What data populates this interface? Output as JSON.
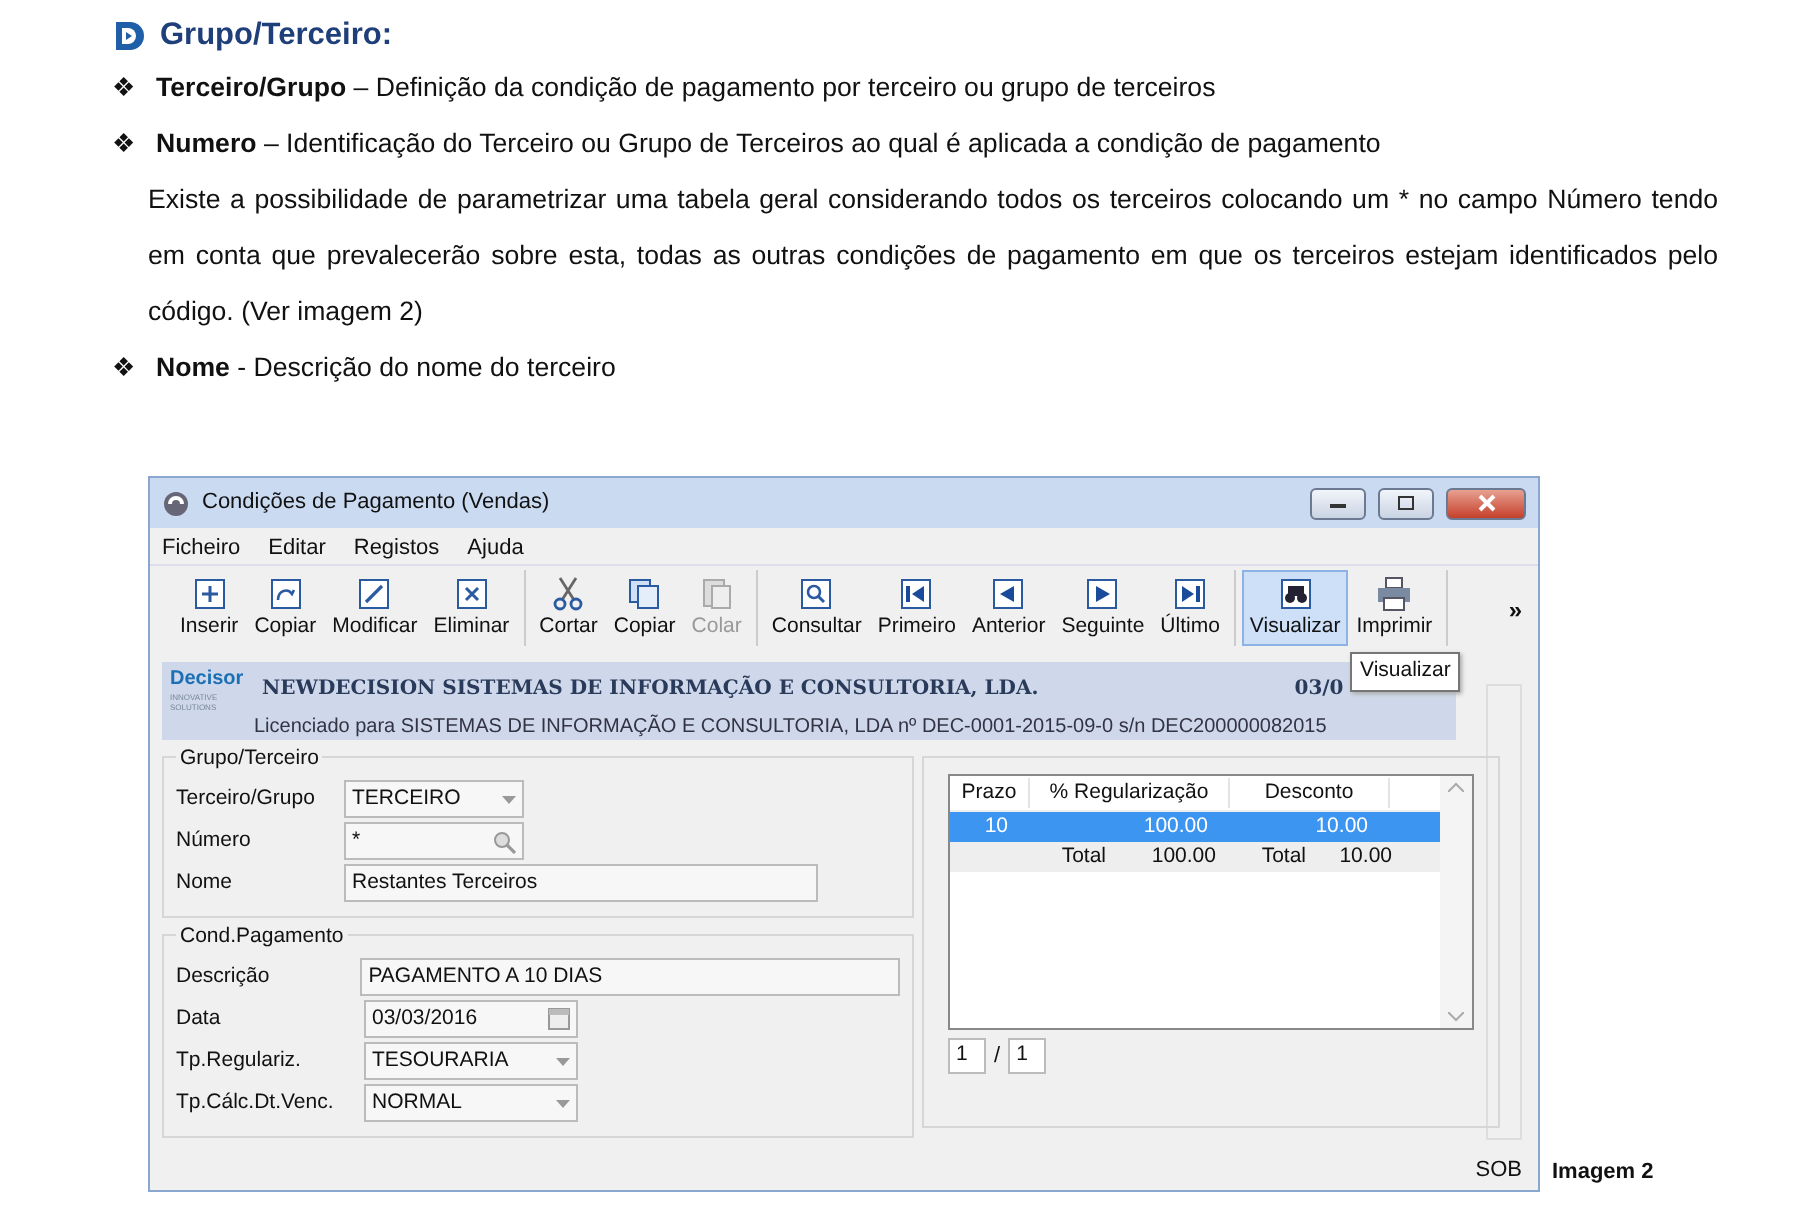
{
  "heading": "Grupo/Terceiro:",
  "items": [
    {
      "kind": "bullet",
      "marker": "❖",
      "text": "**Terceiro/Grupo** – Definição da condição de pagamento por terceiro ou grupo de terceiros"
    },
    {
      "kind": "bullet",
      "marker": "❖",
      "text": "**Numero** – Identificação do Terceiro ou Grupo de Terceiros ao qual é aplicada a condição de pagamento"
    },
    {
      "kind": "para",
      "text": "Existe a possibilidade de parametrizar uma tabela geral considerando todos os terceiros colocando um * no campo Número tendo em conta que prevalecerão sobre esta, todas as outras condições de pagamento em que os terceiros estejam identificados pelo código. (Ver imagem 2)"
    },
    {
      "kind": "bullet",
      "marker": "❖",
      "text": "**Nome** - Descrição do nome do terceiro"
    }
  ],
  "window": {
    "title": "Condições de Pagamento (Vendas)",
    "menu": [
      "Ficheiro",
      "Editar",
      "Registos",
      "Ajuda"
    ],
    "toolbar": [
      [
        {
          "label": "Inserir",
          "disabled": false,
          "selected": false
        },
        {
          "label": "Copiar",
          "disabled": false,
          "selected": false
        },
        {
          "label": "Modificar",
          "disabled": false,
          "selected": false
        },
        {
          "label": "Eliminar",
          "disabled": false,
          "selected": false
        }
      ],
      [
        {
          "label": "Cortar",
          "disabled": false,
          "selected": false
        },
        {
          "label": "Copiar",
          "disabled": false,
          "selected": false
        },
        {
          "label": "Colar",
          "disabled": true,
          "selected": false
        }
      ],
      [
        {
          "label": "Consultar",
          "disabled": false,
          "selected": false
        },
        {
          "label": "Primeiro",
          "disabled": false,
          "selected": false
        },
        {
          "label": "Anterior",
          "disabled": false,
          "selected": false
        },
        {
          "label": "Seguinte",
          "disabled": false,
          "selected": false
        },
        {
          "label": "Último",
          "disabled": false,
          "selected": false
        }
      ],
      [
        {
          "label": "Visualizar",
          "disabled": false,
          "selected": true
        },
        {
          "label": "Imprimir",
          "disabled": false,
          "selected": false
        }
      ]
    ],
    "overflow": "»",
    "tooltip": "Visualizar",
    "header": {
      "logo": "Decisor",
      "logo_sub": "INNOVATIVE SOLUTIONS",
      "company": "NEWDECISION SISTEMAS DE INFORMAÇÃO E CONSULTORIA, LDA.",
      "date": "03/0",
      "license": "Licenciado para  SISTEMAS DE INFORMAÇÃO E CONSULTORIA, LDA nº DEC-0001-2015-09-0 s/n DEC200000082015"
    },
    "groups": [
      {
        "title": "Grupo/Terceiro",
        "fields": [
          {
            "label": "Terceiro/Grupo",
            "kind": "combo",
            "value": "TERCEIRO"
          },
          {
            "label": "Número",
            "kind": "lookup",
            "value": "*"
          },
          {
            "label": "Nome",
            "kind": "text",
            "value": "Restantes Terceiros"
          }
        ]
      },
      {
        "title": "Cond.Pagamento",
        "fields": [
          {
            "label": "Descrição",
            "kind": "text",
            "value": "PAGAMENTO A 10 DIAS"
          },
          {
            "label": "Data",
            "kind": "date",
            "value": "03/03/2016"
          },
          {
            "label": "Tp.Regulariz.",
            "kind": "combo",
            "value": "TESOURARIA"
          },
          {
            "label": "Tp.Cálc.Dt.Venc.",
            "kind": "combo",
            "value": "NORMAL"
          }
        ]
      }
    ],
    "grid": {
      "columns": [
        "Prazo",
        "% Regularização",
        "Desconto"
      ],
      "rows": [
        {
          "kind": "data",
          "selected": true,
          "cells": [
            "10",
            "100.00",
            "10.00"
          ]
        },
        {
          "kind": "total",
          "selected": false,
          "cells": [
            "Total",
            "100.00",
            "Total",
            "10.00"
          ]
        }
      ],
      "pager": [
        "1",
        "/",
        "1"
      ]
    },
    "status": "SOB"
  },
  "caption": "Imagem 2"
}
